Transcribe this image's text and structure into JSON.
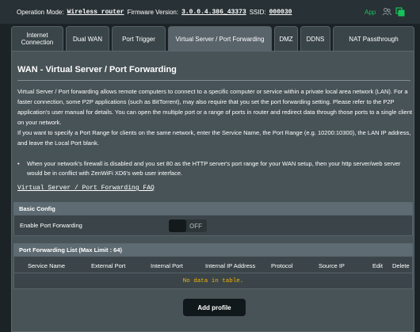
{
  "status_bar": {
    "operation_mode_label": "Operation Mode:",
    "operation_mode_value": "Wireless router",
    "firmware_label": "Firmware Version:",
    "firmware_value": "3.0.0.4.386_43373",
    "ssid_label": "SSID:",
    "ssid_value": "000030",
    "app_label": "App",
    "icons": [
      "people-icon",
      "copy-icon"
    ],
    "colors": {
      "app": "#16c35a",
      "copy_icon": "#16c35a"
    }
  },
  "tabs": [
    {
      "label": "Internet Connection",
      "active": false
    },
    {
      "label": "Dual WAN",
      "active": false
    },
    {
      "label": "Port Trigger",
      "active": false
    },
    {
      "label": "Virtual Server / Port Forwarding",
      "active": true
    },
    {
      "label": "DMZ",
      "active": false
    },
    {
      "label": "DDNS",
      "active": false
    },
    {
      "label": "NAT Passthrough",
      "active": false
    }
  ],
  "page": {
    "title": "WAN - Virtual Server / Port Forwarding",
    "description_1": "Virtual Server / Port forwarding allows remote computers to connect to a specific computer or service within a private local area network (LAN). For a faster connection, some P2P applications (such as BitTorrent), may also require that you set the port forwarding setting. Please refer to the P2P application's user manual for details. You can open the multiple port or a range of ports in router and redirect data through those ports to a single client on your network.",
    "description_2": "If you want to specify a Port Range for clients on the same network, enter the Service Name, the Port Range (e.g. 10200:10300), the LAN IP address, and leave the Local Port blank.",
    "note_bullet": "•",
    "note": "When your network's firewall is disabled and you set 80 as the HTTP server's port range for your WAN setup, then your http server/web server would be in conflict with ZenWiFi XD6's web user interface.",
    "faq_link": "Virtual Server / Port Forwarding FAQ"
  },
  "basic_config": {
    "header": "Basic Config",
    "enable_label": "Enable Port Forwarding",
    "toggle_state": "OFF"
  },
  "port_list": {
    "header": "Port Forwarding List (Max Limit : 64)",
    "columns": [
      "Service Name",
      "External Port",
      "Internal Port",
      "Internal IP Address",
      "Protocol",
      "Source IP",
      "Edit",
      "Delete"
    ],
    "empty_message": "No data in table.",
    "add_button": "Add profile"
  }
}
